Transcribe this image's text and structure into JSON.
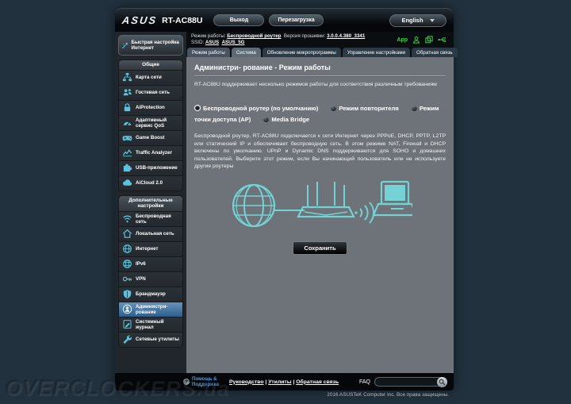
{
  "window": {
    "brand": "ASUS",
    "model": "RT-AC88U",
    "logout_label": "Выход",
    "reboot_label": "Перезагрузка",
    "language": "English"
  },
  "statusbar": {
    "mode_label": "Режим работы:",
    "mode_value": "Беспроводной роутер",
    "firmware_label": "Версия прошивки:",
    "firmware_value": "3.0.0.4.380_3341",
    "ssid_label": "SSID:",
    "ssid_24": "ASUS",
    "ssid_5": "ASUS_5G",
    "app_label": "App"
  },
  "sidebar": {
    "quick_setup": "Быстрая настройка Интернет",
    "groups": [
      {
        "title": "Общие",
        "items": [
          {
            "label": "Карта сети",
            "icon": "sitemap-icon"
          },
          {
            "label": "Гостевая сеть",
            "icon": "guests-icon"
          },
          {
            "label": "AiProtection",
            "icon": "lock-icon"
          },
          {
            "label": "Адаптивный сервис QoS",
            "icon": "gauge-icon"
          },
          {
            "label": "Game Boost",
            "icon": "gamepad-icon"
          },
          {
            "label": "Traffic Analyzer",
            "icon": "chart-icon"
          },
          {
            "label": "USB-приложение",
            "icon": "puzzle-icon"
          },
          {
            "label": "AiCloud 2.0",
            "icon": "cloud-icon"
          }
        ]
      },
      {
        "title": "Дополнительные настройки",
        "items": [
          {
            "label": "Беспроводная сеть",
            "icon": "wifi-icon"
          },
          {
            "label": "Локальная сеть",
            "icon": "home-icon"
          },
          {
            "label": "Интернет",
            "icon": "globe-icon"
          },
          {
            "label": "IPv6",
            "icon": "globe6-icon"
          },
          {
            "label": "VPN",
            "icon": "key-icon"
          },
          {
            "label": "Брандмауэр",
            "icon": "shield-icon"
          },
          {
            "label": "Администри- рование",
            "icon": "admin-icon",
            "active": true
          },
          {
            "label": "Системный журнал",
            "icon": "log-icon"
          },
          {
            "label": "Сетевые утилиты",
            "icon": "wrench-icon"
          }
        ]
      }
    ]
  },
  "tabs": [
    "Режим работы",
    "Система",
    "Обновление микропрограммы",
    "Управление настройками",
    "Обратная связь"
  ],
  "content": {
    "title": "Администри- рование - Режим работы",
    "subtitle": "RT-AC88U поддерживает несколько режимов работы для соответствия различным требованиям",
    "options": [
      {
        "label": "Беспроводной роутер (по умолчанию)",
        "selected": true
      },
      {
        "label": "Режим повторителя",
        "selected": false
      },
      {
        "label": "Режим точки доступа (AP)",
        "selected": false
      },
      {
        "label": "Media Bridge",
        "selected": false
      }
    ],
    "description": "Беспроводной роутер, RT-AC88U подключается к сети Интернет через PPPoE, DHCP, PPTP, L2TP или статический IP и обеспечивает беспроводную сеть. В этом режиме NAT, Firewall и DHCP включены по умолчанию. UPnP и Dynamic DNS поддерживаются для SOHO и домашних пользователей. Выберите этот режим, если Вы начинающий пользователь или не используете другие роутеры",
    "save_label": "Сохранить"
  },
  "footer": {
    "help": "Помощь & Поддержка",
    "help_icon": "?",
    "links": [
      "Руководство",
      "Утилиты",
      "Обратная связь"
    ],
    "separator": "|",
    "faq_label": "FAQ",
    "copyright": "2016 ASUSTeK Computer Inc. Все права защищены."
  },
  "watermark": "OVERCLOCKERS.ua",
  "colors": {
    "accent_cyan": "#5ac4de",
    "illustration_teal": "#74d2d4",
    "status_green": "#35d33c",
    "active_item_blue": "#2d608f",
    "content_bg": "#6d7379"
  }
}
